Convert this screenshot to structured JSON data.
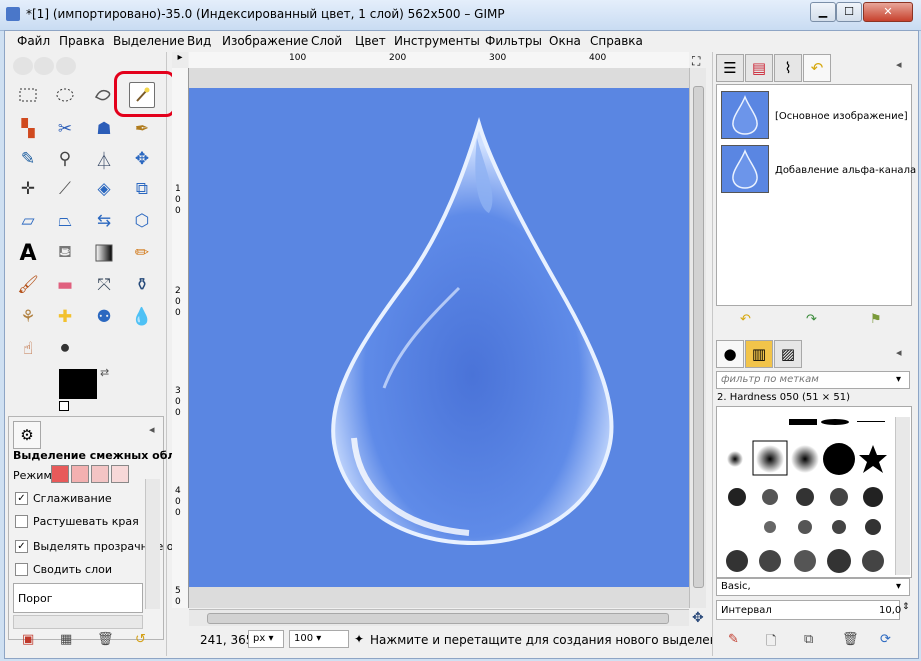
{
  "window": {
    "title": "*[1] (импортировано)-35.0 (Индексированный цвет, 1 слой) 562x500 – GIMP",
    "min_glyph": "▁",
    "max_glyph": "☐",
    "close_glyph": "✕"
  },
  "menubar": [
    "Файл",
    "Правка",
    "Выделение",
    "Вид",
    "Изображение",
    "Слой",
    "Цвет",
    "Инструменты",
    "Фильтры",
    "Окна",
    "Справка"
  ],
  "toolbox": {
    "tool_icons": [
      [
        "rect-select-icon",
        "ellipse-select-icon",
        "free-select-icon",
        "fuzzy-select-icon"
      ],
      [
        "color-select-icon",
        "scissors-select-icon",
        "foreground-select-icon",
        "paths-icon"
      ],
      [
        "color-picker-icon",
        "zoom-icon",
        "measure-icon",
        "move-icon"
      ],
      [
        "align-icon",
        "crop-icon",
        "rotate-icon",
        "scale-icon"
      ],
      [
        "shear-icon",
        "perspective-icon",
        "flip-icon",
        "cage-transform-icon"
      ],
      [
        "text-icon",
        "bucket-fill-icon",
        "blend-icon",
        "pencil-icon"
      ],
      [
        "paintbrush-icon",
        "eraser-icon",
        "airbrush-icon",
        "ink-icon"
      ],
      [
        "clone-icon",
        "heal-icon",
        "perspective-clone-icon",
        "blur-icon"
      ],
      [
        "smudge-icon",
        "dodge-burn-icon"
      ]
    ],
    "colors": {
      "foreground": "#000000",
      "background": "#ffffff"
    }
  },
  "tool_options": {
    "title": "Выделение смежных областей",
    "mode_label": "Режим:",
    "checkboxes": [
      {
        "label": "Сглаживание",
        "checked": true
      },
      {
        "label": "Растушевать края",
        "checked": false
      },
      {
        "label": "Выделять прозрачные о",
        "checked": true
      },
      {
        "label": "Сводить слои",
        "checked": false
      }
    ],
    "threshold_label": "Порог"
  },
  "rulers": {
    "top": [
      "100",
      "200",
      "300",
      "400"
    ],
    "left": [
      "1",
      "0",
      "0",
      "2",
      "0",
      "0",
      "3",
      "0",
      "0",
      "4",
      "0",
      "0",
      "5",
      "0"
    ]
  },
  "canvas": {
    "image_color": "#5a86e2"
  },
  "statusbar": {
    "coords": "241, 365",
    "unit": "px",
    "zoom": "100",
    "hint": "Нажмите и перетащите для создания нового выделения"
  },
  "layers": [
    {
      "name": "[Основное изображение]"
    },
    {
      "name": "Добавление альфа-канала"
    }
  ],
  "brushes": {
    "filter_placeholder": "фильтр по меткам",
    "selected_brush": "2. Hardness 050 (51 × 51)",
    "preset": "Basic,",
    "spacing_label": "Интервал",
    "spacing_value": "10,0"
  }
}
